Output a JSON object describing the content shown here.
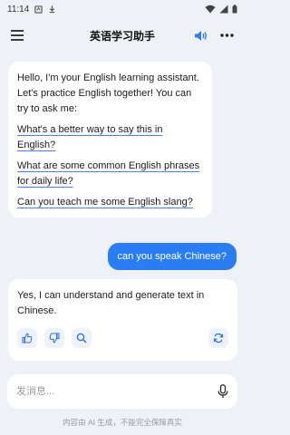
{
  "status_bar": {
    "time": "11:14"
  },
  "header": {
    "title": "英语学习助手"
  },
  "messages": {
    "ai_intro": {
      "text": "Hello, I'm your English learning assistant. Let's practice English together! You can try to ask me:",
      "suggestions": [
        "What's a better way to say this in English?",
        "What are some common English phrases for daily life?",
        "Can you teach me some English slang?"
      ]
    },
    "user_message": "can you speak Chinese?",
    "ai_reply": "Yes, I can understand and generate text in Chinese."
  },
  "input": {
    "placeholder": "发消息..."
  },
  "footer": {
    "disclaimer": "内容由 AI 生成，不能完全保障真实"
  },
  "colors": {
    "accent": "#2a7ef3",
    "background": "#eef1f6"
  },
  "icons": [
    "menu-icon",
    "speaker-icon",
    "more-icon",
    "thumbs-up-icon",
    "thumbs-down-icon",
    "search-icon",
    "refresh-icon",
    "microphone-icon"
  ]
}
